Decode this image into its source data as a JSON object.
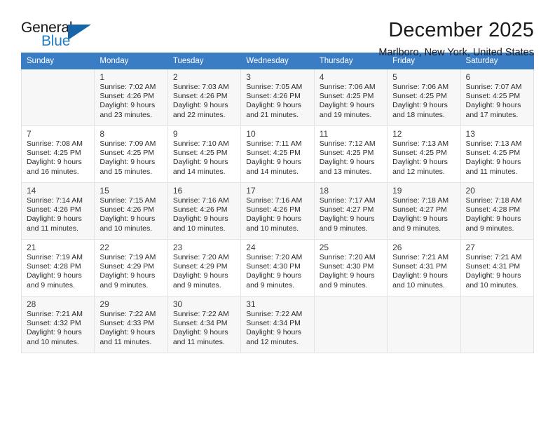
{
  "brand": {
    "name_part1": "General",
    "name_part2": "Blue",
    "accent_color": "#1f7fc4",
    "triangle_color": "#1565a8"
  },
  "header": {
    "title": "December 2025",
    "subtitle": "Marlboro, New York, United States"
  },
  "calendar": {
    "header_bg": "#3b7dc4",
    "weekday_headers": [
      "Sunday",
      "Monday",
      "Tuesday",
      "Wednesday",
      "Thursday",
      "Friday",
      "Saturday"
    ],
    "weeks": [
      [
        {
          "day": "",
          "sunrise": "",
          "sunset": "",
          "daylight_line1": "",
          "daylight_line2": ""
        },
        {
          "day": "1",
          "sunrise": "Sunrise: 7:02 AM",
          "sunset": "Sunset: 4:26 PM",
          "daylight_line1": "Daylight: 9 hours",
          "daylight_line2": "and 23 minutes."
        },
        {
          "day": "2",
          "sunrise": "Sunrise: 7:03 AM",
          "sunset": "Sunset: 4:26 PM",
          "daylight_line1": "Daylight: 9 hours",
          "daylight_line2": "and 22 minutes."
        },
        {
          "day": "3",
          "sunrise": "Sunrise: 7:05 AM",
          "sunset": "Sunset: 4:26 PM",
          "daylight_line1": "Daylight: 9 hours",
          "daylight_line2": "and 21 minutes."
        },
        {
          "day": "4",
          "sunrise": "Sunrise: 7:06 AM",
          "sunset": "Sunset: 4:25 PM",
          "daylight_line1": "Daylight: 9 hours",
          "daylight_line2": "and 19 minutes."
        },
        {
          "day": "5",
          "sunrise": "Sunrise: 7:06 AM",
          "sunset": "Sunset: 4:25 PM",
          "daylight_line1": "Daylight: 9 hours",
          "daylight_line2": "and 18 minutes."
        },
        {
          "day": "6",
          "sunrise": "Sunrise: 7:07 AM",
          "sunset": "Sunset: 4:25 PM",
          "daylight_line1": "Daylight: 9 hours",
          "daylight_line2": "and 17 minutes."
        }
      ],
      [
        {
          "day": "7",
          "sunrise": "Sunrise: 7:08 AM",
          "sunset": "Sunset: 4:25 PM",
          "daylight_line1": "Daylight: 9 hours",
          "daylight_line2": "and 16 minutes."
        },
        {
          "day": "8",
          "sunrise": "Sunrise: 7:09 AM",
          "sunset": "Sunset: 4:25 PM",
          "daylight_line1": "Daylight: 9 hours",
          "daylight_line2": "and 15 minutes."
        },
        {
          "day": "9",
          "sunrise": "Sunrise: 7:10 AM",
          "sunset": "Sunset: 4:25 PM",
          "daylight_line1": "Daylight: 9 hours",
          "daylight_line2": "and 14 minutes."
        },
        {
          "day": "10",
          "sunrise": "Sunrise: 7:11 AM",
          "sunset": "Sunset: 4:25 PM",
          "daylight_line1": "Daylight: 9 hours",
          "daylight_line2": "and 14 minutes."
        },
        {
          "day": "11",
          "sunrise": "Sunrise: 7:12 AM",
          "sunset": "Sunset: 4:25 PM",
          "daylight_line1": "Daylight: 9 hours",
          "daylight_line2": "and 13 minutes."
        },
        {
          "day": "12",
          "sunrise": "Sunrise: 7:13 AM",
          "sunset": "Sunset: 4:25 PM",
          "daylight_line1": "Daylight: 9 hours",
          "daylight_line2": "and 12 minutes."
        },
        {
          "day": "13",
          "sunrise": "Sunrise: 7:13 AM",
          "sunset": "Sunset: 4:25 PM",
          "daylight_line1": "Daylight: 9 hours",
          "daylight_line2": "and 11 minutes."
        }
      ],
      [
        {
          "day": "14",
          "sunrise": "Sunrise: 7:14 AM",
          "sunset": "Sunset: 4:26 PM",
          "daylight_line1": "Daylight: 9 hours",
          "daylight_line2": "and 11 minutes."
        },
        {
          "day": "15",
          "sunrise": "Sunrise: 7:15 AM",
          "sunset": "Sunset: 4:26 PM",
          "daylight_line1": "Daylight: 9 hours",
          "daylight_line2": "and 10 minutes."
        },
        {
          "day": "16",
          "sunrise": "Sunrise: 7:16 AM",
          "sunset": "Sunset: 4:26 PM",
          "daylight_line1": "Daylight: 9 hours",
          "daylight_line2": "and 10 minutes."
        },
        {
          "day": "17",
          "sunrise": "Sunrise: 7:16 AM",
          "sunset": "Sunset: 4:26 PM",
          "daylight_line1": "Daylight: 9 hours",
          "daylight_line2": "and 10 minutes."
        },
        {
          "day": "18",
          "sunrise": "Sunrise: 7:17 AM",
          "sunset": "Sunset: 4:27 PM",
          "daylight_line1": "Daylight: 9 hours",
          "daylight_line2": "and 9 minutes."
        },
        {
          "day": "19",
          "sunrise": "Sunrise: 7:18 AM",
          "sunset": "Sunset: 4:27 PM",
          "daylight_line1": "Daylight: 9 hours",
          "daylight_line2": "and 9 minutes."
        },
        {
          "day": "20",
          "sunrise": "Sunrise: 7:18 AM",
          "sunset": "Sunset: 4:28 PM",
          "daylight_line1": "Daylight: 9 hours",
          "daylight_line2": "and 9 minutes."
        }
      ],
      [
        {
          "day": "21",
          "sunrise": "Sunrise: 7:19 AM",
          "sunset": "Sunset: 4:28 PM",
          "daylight_line1": "Daylight: 9 hours",
          "daylight_line2": "and 9 minutes."
        },
        {
          "day": "22",
          "sunrise": "Sunrise: 7:19 AM",
          "sunset": "Sunset: 4:29 PM",
          "daylight_line1": "Daylight: 9 hours",
          "daylight_line2": "and 9 minutes."
        },
        {
          "day": "23",
          "sunrise": "Sunrise: 7:20 AM",
          "sunset": "Sunset: 4:29 PM",
          "daylight_line1": "Daylight: 9 hours",
          "daylight_line2": "and 9 minutes."
        },
        {
          "day": "24",
          "sunrise": "Sunrise: 7:20 AM",
          "sunset": "Sunset: 4:30 PM",
          "daylight_line1": "Daylight: 9 hours",
          "daylight_line2": "and 9 minutes."
        },
        {
          "day": "25",
          "sunrise": "Sunrise: 7:20 AM",
          "sunset": "Sunset: 4:30 PM",
          "daylight_line1": "Daylight: 9 hours",
          "daylight_line2": "and 9 minutes."
        },
        {
          "day": "26",
          "sunrise": "Sunrise: 7:21 AM",
          "sunset": "Sunset: 4:31 PM",
          "daylight_line1": "Daylight: 9 hours",
          "daylight_line2": "and 10 minutes."
        },
        {
          "day": "27",
          "sunrise": "Sunrise: 7:21 AM",
          "sunset": "Sunset: 4:31 PM",
          "daylight_line1": "Daylight: 9 hours",
          "daylight_line2": "and 10 minutes."
        }
      ],
      [
        {
          "day": "28",
          "sunrise": "Sunrise: 7:21 AM",
          "sunset": "Sunset: 4:32 PM",
          "daylight_line1": "Daylight: 9 hours",
          "daylight_line2": "and 10 minutes."
        },
        {
          "day": "29",
          "sunrise": "Sunrise: 7:22 AM",
          "sunset": "Sunset: 4:33 PM",
          "daylight_line1": "Daylight: 9 hours",
          "daylight_line2": "and 11 minutes."
        },
        {
          "day": "30",
          "sunrise": "Sunrise: 7:22 AM",
          "sunset": "Sunset: 4:34 PM",
          "daylight_line1": "Daylight: 9 hours",
          "daylight_line2": "and 11 minutes."
        },
        {
          "day": "31",
          "sunrise": "Sunrise: 7:22 AM",
          "sunset": "Sunset: 4:34 PM",
          "daylight_line1": "Daylight: 9 hours",
          "daylight_line2": "and 12 minutes."
        },
        {
          "day": "",
          "sunrise": "",
          "sunset": "",
          "daylight_line1": "",
          "daylight_line2": ""
        },
        {
          "day": "",
          "sunrise": "",
          "sunset": "",
          "daylight_line1": "",
          "daylight_line2": ""
        },
        {
          "day": "",
          "sunrise": "",
          "sunset": "",
          "daylight_line1": "",
          "daylight_line2": ""
        }
      ]
    ]
  }
}
